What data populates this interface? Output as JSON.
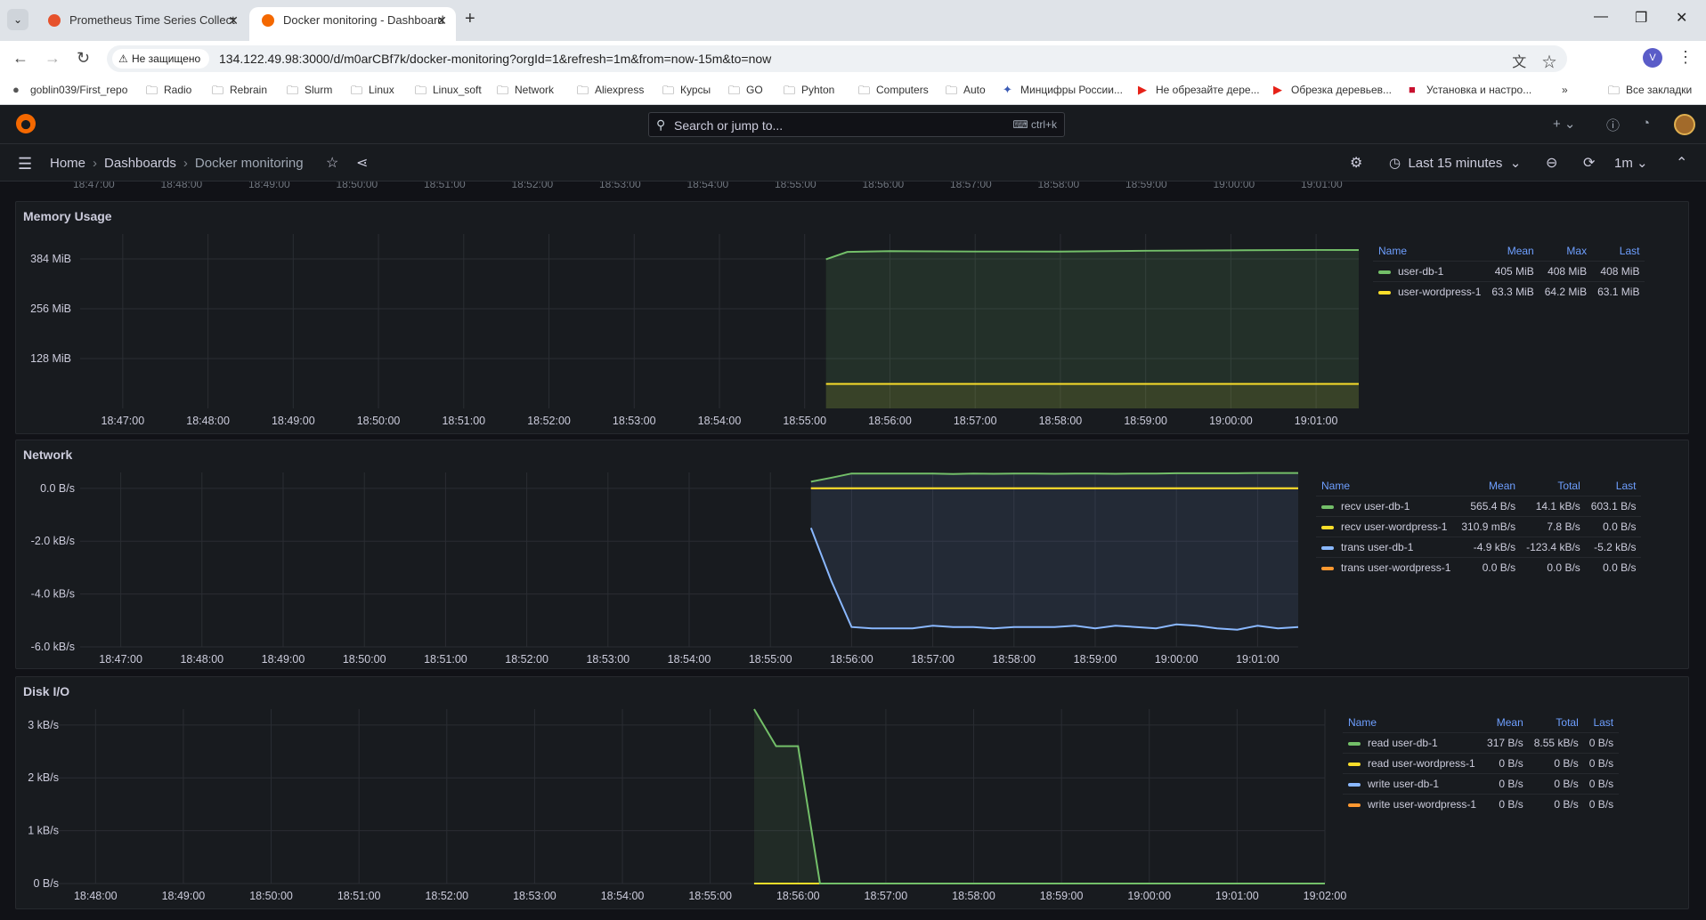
{
  "browser": {
    "tabs": [
      {
        "title": "Prometheus Time Series Collect",
        "active": false
      },
      {
        "title": "Docker monitoring - Dashboard",
        "active": true
      }
    ],
    "security_label": "Не защищено",
    "url": "134.122.49.98:3000/d/m0arCBf7k/docker-monitoring?orgId=1&refresh=1m&from=now-15m&to=now",
    "profile_initial": "V",
    "bookmarks": [
      {
        "label": "goblin039/First_repo",
        "icon": "github-icon"
      },
      {
        "label": "Radio",
        "icon": "folder-icon"
      },
      {
        "label": "Rebrain",
        "icon": "folder-icon"
      },
      {
        "label": "Slurm",
        "icon": "folder-icon"
      },
      {
        "label": "Linux",
        "icon": "folder-icon"
      },
      {
        "label": "Linux_soft",
        "icon": "folder-icon"
      },
      {
        "label": "Network",
        "icon": "folder-icon"
      },
      {
        "label": "Aliexpress",
        "icon": "folder-icon"
      },
      {
        "label": "Курсы",
        "icon": "folder-icon"
      },
      {
        "label": "GO",
        "icon": "folder-icon"
      },
      {
        "label": "Pyhton",
        "icon": "folder-icon"
      },
      {
        "label": "Computers",
        "icon": "folder-icon"
      },
      {
        "label": "Auto",
        "icon": "folder-icon"
      },
      {
        "label": "Минцифры России...",
        "icon": "emblem-icon"
      },
      {
        "label": "Не обрезайте дере...",
        "icon": "youtube-icon"
      },
      {
        "label": "Обрезка деревьев...",
        "icon": "youtube-icon"
      },
      {
        "label": "Установка и настро...",
        "icon": "site-icon"
      }
    ],
    "all_bookmarks": "Все закладки"
  },
  "grafana": {
    "search_placeholder": "Search or jump to...",
    "search_shortcut": "ctrl+k",
    "breadcrumb": [
      "Home",
      "Dashboards",
      "Docker monitoring"
    ],
    "time_range": "Last 15 minutes",
    "refresh_interval": "1m",
    "top_axis_ticks": [
      "18:47:00",
      "18:48:00",
      "18:49:00",
      "18:50:00",
      "18:51:00",
      "18:52:00",
      "18:53:00",
      "18:54:00",
      "18:55:00",
      "18:56:00",
      "18:57:00",
      "18:58:00",
      "18:59:00",
      "19:00:00",
      "19:01:00"
    ]
  },
  "colors": {
    "green": "#73bf69",
    "yellow": "#fade2a",
    "blue": "#8ab8ff",
    "orange": "#ff9830"
  },
  "chart_data": [
    {
      "type": "area",
      "title": "Memory Usage",
      "xlabel": "",
      "ylabel": "",
      "x_ticks": [
        "18:47:00",
        "18:48:00",
        "18:49:00",
        "18:50:00",
        "18:51:00",
        "18:52:00",
        "18:53:00",
        "18:54:00",
        "18:55:00",
        "18:56:00",
        "18:57:00",
        "18:58:00",
        "18:59:00",
        "19:00:00",
        "19:01:00"
      ],
      "y_ticks": [
        "128 MiB",
        "256 MiB",
        "384 MiB"
      ],
      "ylim": [
        0,
        448
      ],
      "grid": true,
      "legend_position": "right",
      "legend_columns": [
        "Name",
        "Mean",
        "Max",
        "Last"
      ],
      "x": [
        "18:55:15",
        "18:55:30",
        "18:56:00",
        "18:57:00",
        "18:58:00",
        "18:59:00",
        "19:00:00",
        "19:01:00",
        "19:01:30"
      ],
      "series": [
        {
          "name": "user-db-1",
          "color": "#73bf69",
          "values": [
            383,
            402,
            404,
            403,
            403,
            405,
            406,
            407,
            407
          ],
          "mean": "405 MiB",
          "max": "408 MiB",
          "last": "408 MiB"
        },
        {
          "name": "user-wordpress-1",
          "color": "#fade2a",
          "values": [
            63,
            63,
            63,
            63,
            63,
            63,
            63,
            63,
            63
          ],
          "mean": "63.3 MiB",
          "max": "64.2 MiB",
          "last": "63.1 MiB"
        }
      ]
    },
    {
      "type": "area",
      "title": "Network",
      "xlabel": "",
      "ylabel": "",
      "x_ticks": [
        "18:47:00",
        "18:48:00",
        "18:49:00",
        "18:50:00",
        "18:51:00",
        "18:52:00",
        "18:53:00",
        "18:54:00",
        "18:55:00",
        "18:56:00",
        "18:57:00",
        "18:58:00",
        "18:59:00",
        "19:00:00",
        "19:01:00"
      ],
      "y_ticks": [
        "0.0 B/s",
        "-2.0 kB/s",
        "-4.0 kB/s",
        "-6.0 kB/s"
      ],
      "ylim": [
        -6000,
        600
      ],
      "grid": true,
      "legend_position": "right",
      "legend_columns": [
        "Name",
        "Mean",
        "Total",
        "Last"
      ],
      "x": [
        "18:55:30",
        "18:55:45",
        "18:56:00",
        "18:56:15",
        "18:56:30",
        "18:56:45",
        "18:57:00",
        "18:57:15",
        "18:57:30",
        "18:57:45",
        "18:58:00",
        "18:58:15",
        "18:58:30",
        "18:58:45",
        "18:59:00",
        "18:59:15",
        "18:59:30",
        "18:59:45",
        "19:00:00",
        "19:00:15",
        "19:00:30",
        "19:00:45",
        "19:01:00",
        "19:01:15",
        "19:01:30"
      ],
      "series": [
        {
          "name": "recv user-db-1",
          "color": "#73bf69",
          "values": [
            250,
            400,
            560,
            560,
            560,
            560,
            560,
            540,
            560,
            550,
            560,
            560,
            550,
            560,
            560,
            550,
            560,
            560,
            570,
            570,
            570,
            570,
            580,
            580,
            580
          ],
          "mean": "565.4 B/s",
          "total": "14.1 kB/s",
          "last": "603.1 B/s"
        },
        {
          "name": "recv user-wordpress-1",
          "color": "#fade2a",
          "values": [
            0.3,
            0.3,
            0.3,
            0.3,
            0.3,
            0.3,
            0.3,
            0.3,
            0.3,
            0.3,
            0.3,
            0.3,
            0.3,
            0.3,
            0.3,
            0.3,
            0.3,
            0.3,
            0.3,
            0.3,
            0.3,
            0.3,
            0.3,
            0.3,
            0.3
          ],
          "mean": "310.9 mB/s",
          "total": "7.8 B/s",
          "last": "0.0 B/s"
        },
        {
          "name": "trans user-db-1",
          "color": "#8ab8ff",
          "values": [
            -1500,
            -3500,
            -5250,
            -5300,
            -5300,
            -5300,
            -5200,
            -5250,
            -5250,
            -5300,
            -5250,
            -5250,
            -5250,
            -5200,
            -5300,
            -5200,
            -5250,
            -5300,
            -5150,
            -5200,
            -5300,
            -5350,
            -5200,
            -5300,
            -5250
          ],
          "mean": "-4.9 kB/s",
          "total": "-123.4 kB/s",
          "last": "-5.2 kB/s"
        },
        {
          "name": "trans user-wordpress-1",
          "color": "#ff9830",
          "values": [
            0,
            0,
            0,
            0,
            0,
            0,
            0,
            0,
            0,
            0,
            0,
            0,
            0,
            0,
            0,
            0,
            0,
            0,
            0,
            0,
            0,
            0,
            0,
            0,
            0
          ],
          "mean": "0.0 B/s",
          "total": "0.0 B/s",
          "last": "0.0 B/s"
        }
      ]
    },
    {
      "type": "area",
      "title": "Disk I/O",
      "xlabel": "",
      "ylabel": "",
      "x_ticks": [
        "18:48:00",
        "18:49:00",
        "18:50:00",
        "18:51:00",
        "18:52:00",
        "18:53:00",
        "18:54:00",
        "18:55:00",
        "18:56:00",
        "18:57:00",
        "18:58:00",
        "18:59:00",
        "19:00:00",
        "19:01:00",
        "19:02:00"
      ],
      "y_ticks": [
        "0 B/s",
        "1 kB/s",
        "2 kB/s",
        "3 kB/s"
      ],
      "ylim": [
        0,
        3300
      ],
      "grid": true,
      "legend_position": "right",
      "legend_columns": [
        "Name",
        "Mean",
        "Total",
        "Last"
      ],
      "x": [
        "18:55:30",
        "18:55:45",
        "18:56:00",
        "18:56:15",
        "18:57:00",
        "18:58:00",
        "18:59:00",
        "19:00:00",
        "19:01:00",
        "19:02:00"
      ],
      "series": [
        {
          "name": "read user-db-1",
          "color": "#73bf69",
          "values": [
            3300,
            2600,
            2600,
            0,
            0,
            0,
            0,
            0,
            0,
            0
          ],
          "mean": "317 B/s",
          "total": "8.55 kB/s",
          "last": "0 B/s"
        },
        {
          "name": "read user-wordpress-1",
          "color": "#fade2a",
          "values": [
            0,
            0,
            0,
            0,
            0,
            0,
            0,
            0,
            0,
            0
          ],
          "mean": "0 B/s",
          "total": "0 B/s",
          "last": "0 B/s"
        },
        {
          "name": "write user-db-1",
          "color": "#8ab8ff",
          "values": [
            0,
            0,
            0,
            0,
            0,
            0,
            0,
            0,
            0,
            0
          ],
          "mean": "0 B/s",
          "total": "0 B/s",
          "last": "0 B/s"
        },
        {
          "name": "write user-wordpress-1",
          "color": "#ff9830",
          "values": [
            0,
            0,
            0,
            0,
            0,
            0,
            0,
            0,
            0,
            0
          ],
          "mean": "0 B/s",
          "total": "0 B/s",
          "last": "0 B/s"
        }
      ]
    }
  ]
}
